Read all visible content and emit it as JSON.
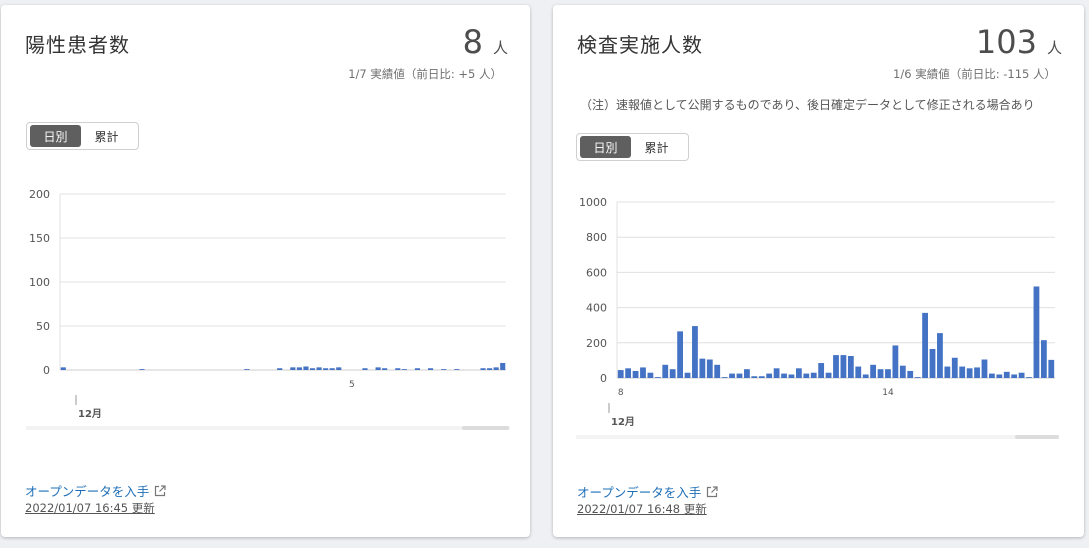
{
  "colors": {
    "bar": "#4472c4",
    "grid": "#e0e0e0",
    "axis": "#cccccc",
    "link": "#1e6fb8"
  },
  "cards": [
    {
      "title": "陽性患者数",
      "value": "8",
      "unit": "人",
      "note": "1/7 実績値（前日比: +5 人）",
      "caveat": "",
      "toggle": [
        "日別",
        "累計"
      ],
      "toggle_active": 0,
      "open_data_label": "オープンデータを入手",
      "updated_label": "2022/01/07 16:45 更新",
      "external_icon": "external-link-icon"
    },
    {
      "title": "検査実施人数",
      "value": "103",
      "unit": "人",
      "note": "1/6 実績値（前日比: -115 人）",
      "caveat": "（注）速報値として公開するものであり、後日確定データとして修正される場合あり",
      "toggle": [
        "日別",
        "累計"
      ],
      "toggle_active": 0,
      "open_data_label": "オープンデータを入手",
      "updated_label": "2022/01/07 16:48 更新",
      "external_icon": "external-link-icon"
    }
  ],
  "chart_data": [
    {
      "type": "bar",
      "ylim": [
        0,
        200
      ],
      "yticks": [
        0,
        50,
        100,
        150,
        200
      ],
      "xtick_labels": [
        {
          "index": 44,
          "label": "5"
        }
      ],
      "month_label": "12月",
      "values": [
        3,
        0,
        0,
        0,
        0,
        0,
        0,
        0,
        0,
        0,
        0,
        0,
        1,
        0,
        0,
        0,
        0,
        0,
        0,
        0,
        0,
        0,
        0,
        0,
        0,
        0,
        0,
        0,
        1,
        0,
        0,
        0,
        0,
        2,
        0,
        3,
        3,
        4,
        2,
        3,
        2,
        2,
        3,
        0,
        0,
        0,
        2,
        0,
        3,
        2,
        0,
        2,
        1,
        0,
        2,
        0,
        2,
        0,
        1,
        0,
        1,
        0,
        0,
        0,
        2,
        2,
        3,
        8
      ]
    },
    {
      "type": "bar",
      "ylim": [
        0,
        1000
      ],
      "yticks": [
        0,
        200,
        400,
        600,
        800,
        1000
      ],
      "xtick_labels": [
        {
          "index": 0,
          "label": "8"
        },
        {
          "index": 36,
          "label": "14"
        }
      ],
      "month_label": "12月",
      "values": [
        45,
        55,
        40,
        60,
        30,
        5,
        75,
        50,
        265,
        30,
        295,
        110,
        105,
        75,
        5,
        25,
        25,
        50,
        10,
        10,
        25,
        55,
        25,
        20,
        55,
        25,
        30,
        85,
        30,
        130,
        130,
        125,
        65,
        20,
        75,
        50,
        50,
        185,
        70,
        40,
        5,
        370,
        165,
        255,
        65,
        115,
        65,
        55,
        60,
        105,
        25,
        20,
        35,
        20,
        30,
        5,
        520,
        215,
        103
      ]
    }
  ]
}
